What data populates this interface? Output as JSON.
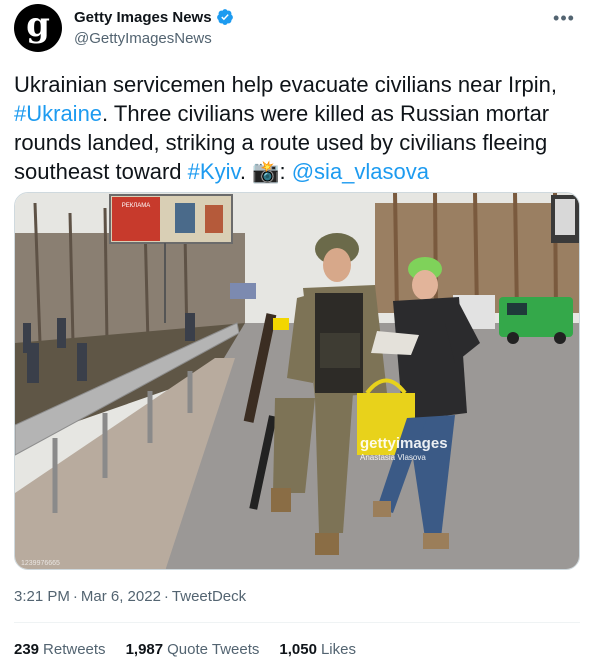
{
  "author": {
    "avatar_letter": "g",
    "display_name": "Getty Images News",
    "handle": "@GettyImagesNews",
    "verified_icon": "verified-badge-icon"
  },
  "more_icon": "more-icon",
  "tweet": {
    "text_1": "Ukrainian servicemen help  evacuate civilians near Irpin, ",
    "hashtag_1": "#Ukraine",
    "text_2": ". Three civilians were killed as Russian mortar rounds landed, striking a route used by civilians fleeing southeast toward ",
    "hashtag_2": "#Kyiv",
    "text_3": ". ",
    "camera_emoji": "📸",
    "text_4": ": ",
    "mention": "@sia_vlasova"
  },
  "media": {
    "watermark_logo": "gettyimages",
    "watermark_credit": "Anastasia Vlasova",
    "image_id": "1239976665",
    "billboard_text": [
      "РЕКЛАМА"
    ],
    "colors": {
      "sky": "#e6e6e2",
      "road": "#9b9896",
      "camo": "#7d7356",
      "jacket": "#2b2b2d",
      "bag": "#e8d21b",
      "van": "#34a84a"
    }
  },
  "meta": {
    "time": "3:21 PM",
    "date": "Mar 6, 2022",
    "client": "TweetDeck",
    "separator": "·"
  },
  "stats": {
    "retweets_count": "239",
    "retweets_label": "Retweets",
    "quotes_count": "1,987",
    "quotes_label": "Quote Tweets",
    "likes_count": "1,050",
    "likes_label": "Likes"
  },
  "theme": {
    "link": "#1d9bf0",
    "text": "#0f1419",
    "muted": "#536471",
    "verified": "#1d9bf0"
  }
}
